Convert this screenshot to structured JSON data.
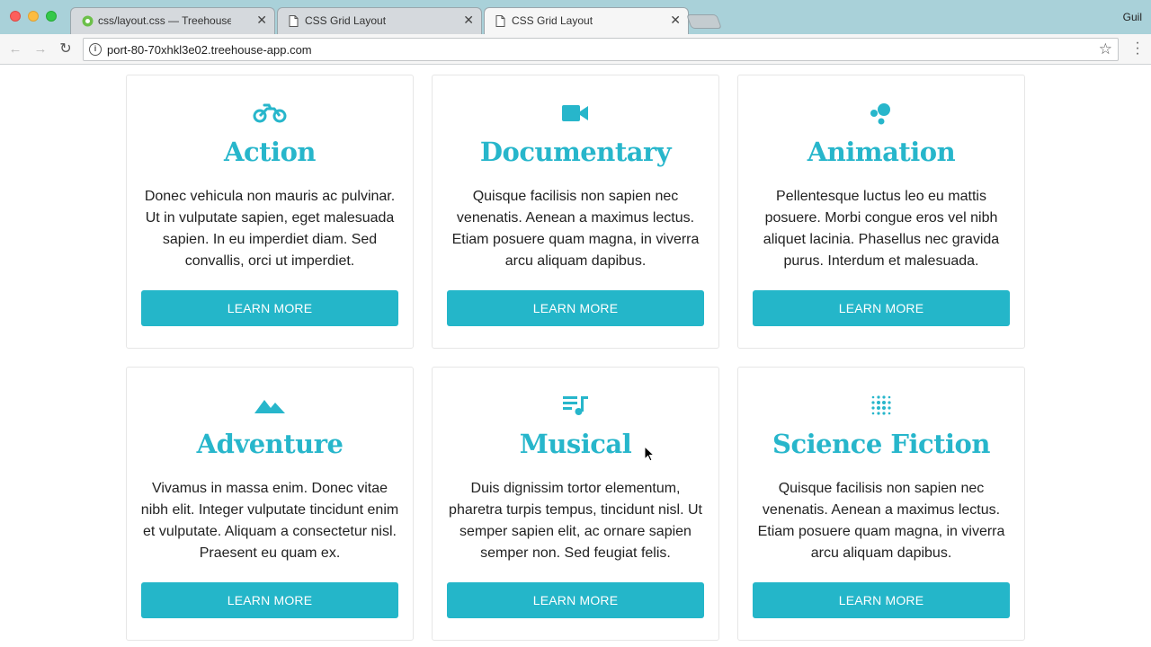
{
  "browser": {
    "tabs": [
      {
        "title": "css/layout.css — Treehouse W",
        "favicon": "treehouse-icon",
        "active": false
      },
      {
        "title": "CSS Grid Layout",
        "favicon": "page-icon",
        "active": false
      },
      {
        "title": "CSS Grid Layout",
        "favicon": "page-icon",
        "active": true
      }
    ],
    "profile_name": "Guil",
    "url": "port-80-70xhkl3e02.treehouse-app.com",
    "close_glyph": "✕"
  },
  "colors": {
    "accent": "#27b6cb",
    "button": "#24b6c9",
    "tabstrip": "#a9d1d9"
  },
  "cards": [
    {
      "icon": "motorcycle-icon",
      "title": "Action",
      "text": "Donec vehicula non mauris ac pulvinar. Ut in vulputate sapien, eget malesuada sapien. In eu imperdiet diam. Sed convallis, orci ut imperdiet.",
      "button": "LEARN MORE"
    },
    {
      "icon": "video-camera-icon",
      "title": "Documentary",
      "text": "Quisque facilisis non sapien nec venenatis. Aenean a maximus lectus. Etiam posuere quam magna, in viverra arcu aliquam dapibus.",
      "button": "LEARN MORE"
    },
    {
      "icon": "bubbles-icon",
      "title": "Animation",
      "text": "Pellentesque luctus leo eu mattis posuere. Morbi congue eros vel nibh aliquet lacinia. Phasellus nec gravida purus. Interdum et malesuada.",
      "button": "LEARN MORE"
    },
    {
      "icon": "mountains-icon",
      "title": "Adventure",
      "text": "Vivamus in massa enim. Donec vitae nibh elit. Integer vulputate tincidunt enim et vulputate. Aliquam a consectetur nisl. Praesent eu quam ex.",
      "button": "LEARN MORE"
    },
    {
      "icon": "music-playlist-icon",
      "title": "Musical",
      "text": "Duis dignissim tortor elementum, pharetra turpis tempus, tincidunt nisl. Ut semper sapien elit, ac ornare sapien semper non. Sed feugiat felis.",
      "button": "LEARN MORE"
    },
    {
      "icon": "dots-grid-icon",
      "title": "Science Fiction",
      "text": "Quisque facilisis non sapien nec venenatis. Aenean a maximus lectus. Etiam posuere quam magna, in viverra arcu aliquam dapibus.",
      "button": "LEARN MORE"
    }
  ]
}
